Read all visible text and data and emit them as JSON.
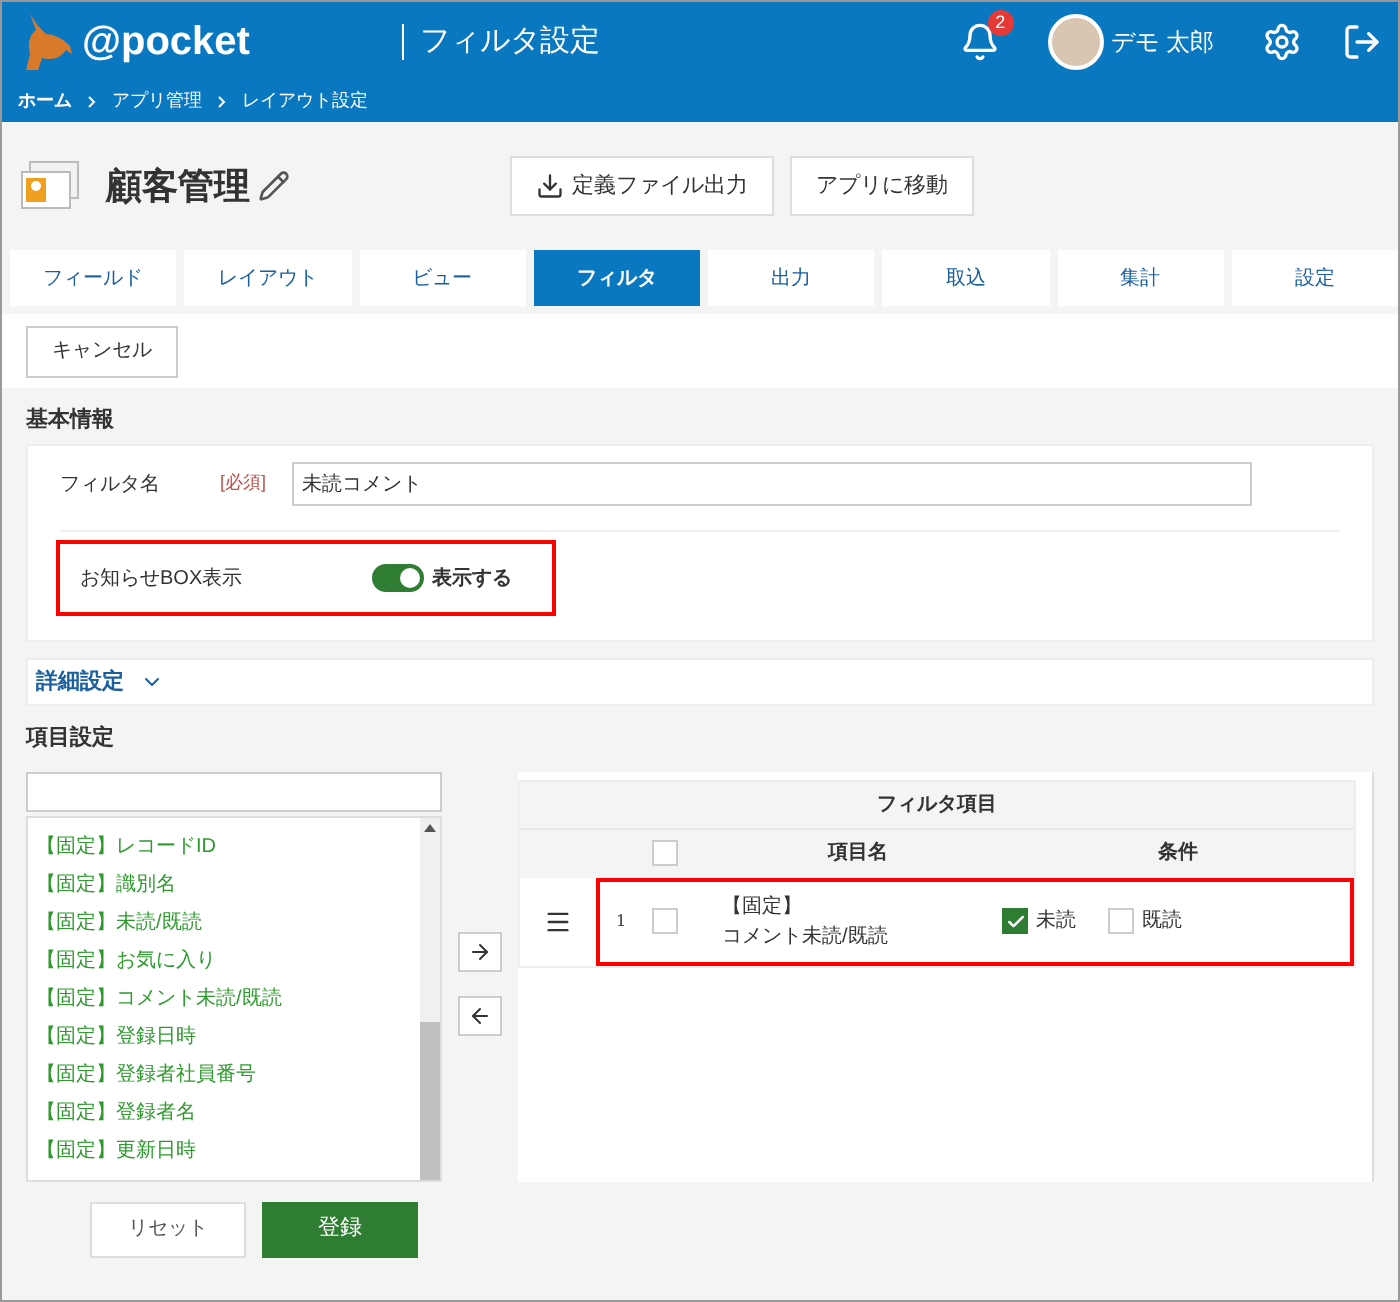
{
  "header": {
    "logo": "@pocket",
    "title": "フィルタ設定",
    "notifications": "2",
    "user": "デモ 太郎"
  },
  "breadcrumb": [
    "ホーム",
    "アプリ管理",
    "レイアウト設定"
  ],
  "app": {
    "title": "顧客管理",
    "buttons": [
      "定義ファイル出力",
      "アプリに移動"
    ]
  },
  "tabs": [
    {
      "label": "フィールド",
      "selected": false
    },
    {
      "label": "レイアウト",
      "selected": false
    },
    {
      "label": "ビュー",
      "selected": false
    },
    {
      "label": "フィルタ",
      "selected": true
    },
    {
      "label": "出力",
      "selected": false
    },
    {
      "label": "取込",
      "selected": false
    },
    {
      "label": "集計",
      "selected": false
    },
    {
      "label": "設定",
      "selected": false
    }
  ],
  "cancel": "キャンセル",
  "basic": {
    "title": "基本情報",
    "name_label": "フィルタ名",
    "required": "[必須]",
    "name_value": "未読コメント",
    "notice_label": "お知らせBOX表示",
    "notice_on": true,
    "notice_text": "表示する",
    "highlighted": true
  },
  "detail": {
    "title": "詳細設定",
    "expanded": false
  },
  "items": {
    "title": "項目設定",
    "list": [
      "【固定】レコードID",
      "【固定】識別名",
      "【固定】未読/既読",
      "【固定】お気に入り",
      "【固定】コメント未読/既読",
      "【固定】登録日時",
      "【固定】登録者社員番号",
      "【固定】登録者名",
      "【固定】更新日時"
    ],
    "table_title": "フィルタ項目",
    "columns": [
      "項目名",
      "条件"
    ],
    "all_checked": false,
    "rows": [
      {
        "number": "1",
        "checked": false,
        "name": "【固定】",
        "name2": "コメント未読/既読",
        "highlighted": true,
        "conditions": [
          {
            "label": "未読",
            "checked": true
          },
          {
            "label": "既読",
            "checked": false
          }
        ]
      }
    ]
  },
  "footer": [
    "リセット",
    "登録"
  ]
}
